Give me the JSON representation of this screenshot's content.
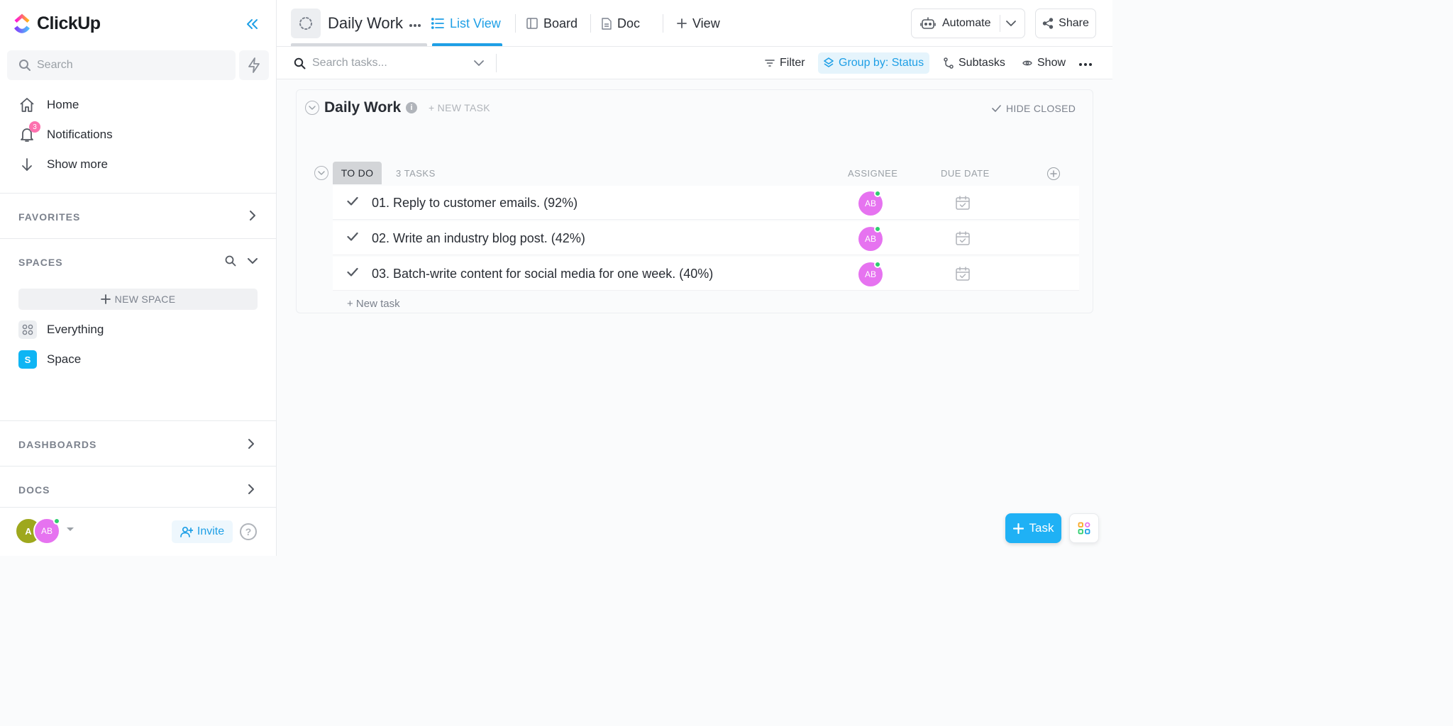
{
  "sidebar": {
    "brand": "ClickUp",
    "search_placeholder": "Search",
    "nav": [
      {
        "label": "Home",
        "icon": "home-icon"
      },
      {
        "label": "Notifications",
        "icon": "bell-icon",
        "badge": "3"
      },
      {
        "label": "Show more",
        "icon": "arrow-down-icon"
      }
    ],
    "favorites_title": "FAVORITES",
    "spaces_title": "SPACES",
    "new_space_label": "NEW SPACE",
    "spaces": [
      {
        "label": "Everything",
        "icon": "grid-icon"
      },
      {
        "label": "Space",
        "initial": "S",
        "color": "#0fb5f4"
      }
    ],
    "dashboards_title": "DASHBOARDS",
    "docs_title": "DOCS",
    "footer": {
      "avatar_initial": "A",
      "avatar_color": "#9ea81d",
      "user_initials": "AB",
      "invite_label": "Invite",
      "help_label": "?"
    }
  },
  "topbar": {
    "title": "Daily Work",
    "tabs": [
      {
        "label": "List View",
        "icon": "list-icon",
        "active": true
      },
      {
        "label": "Board",
        "icon": "board-icon"
      },
      {
        "label": "Doc",
        "icon": "doc-icon"
      },
      {
        "label": "View",
        "icon": "plus-icon"
      }
    ],
    "automate_label": "Automate",
    "share_label": "Share"
  },
  "toolbar": {
    "search_placeholder": "Search tasks...",
    "filter_label": "Filter",
    "group_label": "Group by: Status",
    "subtasks_label": "Subtasks",
    "show_label": "Show"
  },
  "list": {
    "title": "Daily Work",
    "new_task_label": "+ NEW TASK",
    "hide_closed_label": "HIDE CLOSED",
    "group": {
      "status": "TO DO",
      "count_label": "3 TASKS",
      "columns": [
        "ASSIGNEE",
        "DUE DATE"
      ],
      "tasks": [
        {
          "name": "01. Reply to customer emails. (92%)",
          "assignee": "AB"
        },
        {
          "name": "02. Write an industry blog post. (42%)",
          "assignee": "AB"
        },
        {
          "name": "03. Batch-write content for social media for one week. (40%)",
          "assignee": "AB"
        }
      ],
      "new_task_label": "+ New task"
    }
  },
  "fab": {
    "task_label": "Task"
  },
  "colors": {
    "accent": "#1e9fe6",
    "avatar": "#e673f0",
    "online": "#2ecd6f",
    "badge": "#fd71af"
  }
}
